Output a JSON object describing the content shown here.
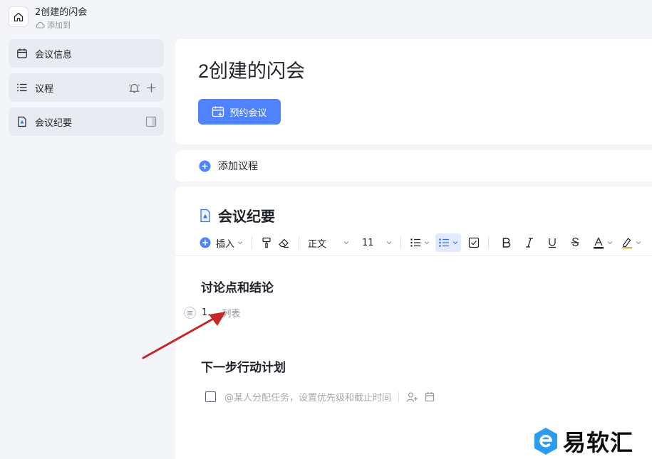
{
  "header": {
    "title": "2创建的闪会",
    "subtitle": "添加到"
  },
  "sidebar": {
    "items": [
      {
        "label": "会议信息"
      },
      {
        "label": "议程"
      },
      {
        "label": "会议纪要"
      }
    ]
  },
  "meeting": {
    "title": "2创建的闪会",
    "book_button": "预约会议"
  },
  "agenda": {
    "add_label": "添加议程"
  },
  "notes": {
    "title": "会议纪要",
    "toolbar": {
      "insert": "插入",
      "style": "正文",
      "font_size": "11"
    },
    "section1_heading": "讨论点和结论",
    "list_number": "1.",
    "list_placeholder": "列表",
    "section2_heading": "下一步行动计划",
    "task_placeholder": "@某人分配任务，设置优先级和截止时间"
  },
  "watermark": {
    "text": "易软汇"
  },
  "colors": {
    "accent": "#4e83fd",
    "annotation_arrow": "#c62828",
    "watermark_icon": "#2b9cf2"
  }
}
